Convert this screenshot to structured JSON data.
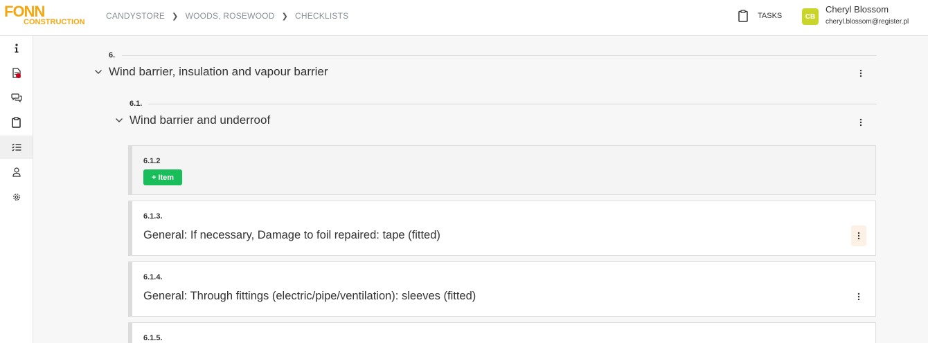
{
  "header": {
    "logo_top": "FONN",
    "logo_bottom": "CONSTRUCTION",
    "breadcrumb": [
      "CANDYSTORE",
      "WOODS, ROSEWOOD",
      "CHECKLISTS"
    ],
    "tasks_label": "TASKS",
    "user": {
      "initials": "CB",
      "name": "Cheryl Blossom",
      "email": "cheryl.blossom@register.pl"
    }
  },
  "sidebar": {
    "items": [
      {
        "icon": "info-icon"
      },
      {
        "icon": "document-icon",
        "notification": true
      },
      {
        "icon": "chat-icon"
      },
      {
        "icon": "clipboard-icon"
      },
      {
        "icon": "checklist-icon",
        "active": true
      },
      {
        "icon": "user-icon"
      },
      {
        "icon": "gear-icon"
      }
    ]
  },
  "checklist": {
    "section": {
      "number": "6.",
      "title": "Wind barrier, insulation and vapour barrier"
    },
    "subsection": {
      "number": "6.1.",
      "title": "Wind barrier and underroof"
    },
    "add_item": {
      "number": "6.1.2",
      "button_label": "+ Item"
    },
    "items": [
      {
        "number": "6.1.3.",
        "text": "General: If necessary, Damage to foil repaired: tape (fitted)"
      },
      {
        "number": "6.1.4.",
        "text": "General: Through fittings (electric/pipe/ventilation): sleeves (fitted)"
      },
      {
        "number": "6.1.5.",
        "text": ""
      }
    ]
  },
  "colors": {
    "brand": "#f3a712",
    "accent_green": "#19bd5a",
    "avatar": "#c9d629",
    "notification": "#d0021b"
  }
}
